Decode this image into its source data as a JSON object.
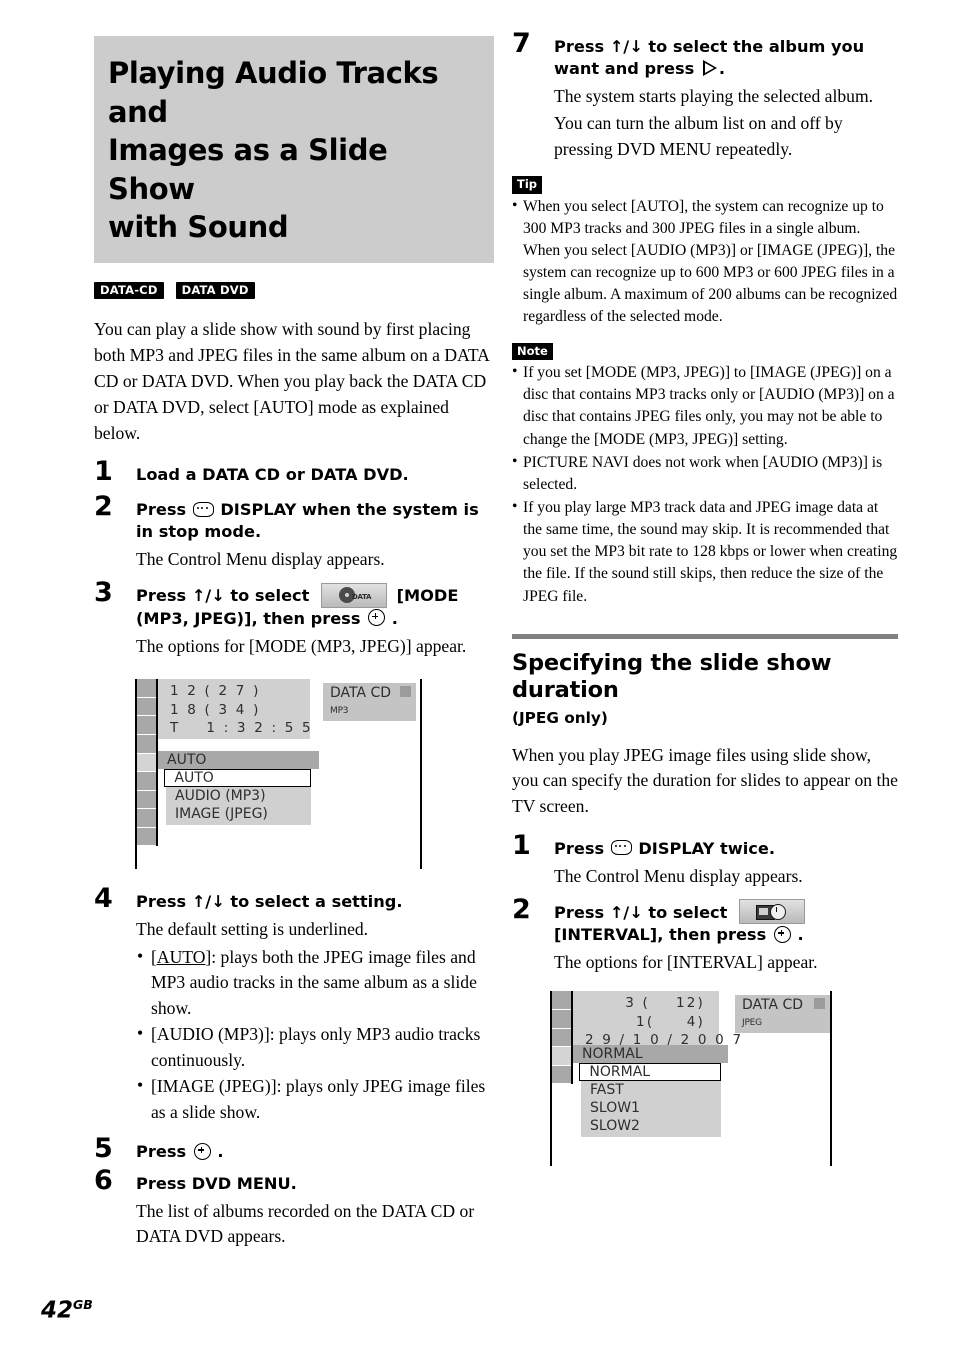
{
  "page": {
    "number": "42",
    "region": "GB"
  },
  "chapter": {
    "title_lines": [
      "Playing Audio Tracks and",
      "Images as a Slide Show",
      "with Sound"
    ],
    "badges": [
      "DATA-CD",
      "DATA DVD"
    ],
    "intro": "You can play a slide show with sound by first placing both MP3 and JPEG files in the same album on a DATA CD or DATA DVD. When you play back the DATA CD or DATA DVD, select [AUTO] mode as explained below."
  },
  "steps_main": [
    {
      "num": "1",
      "head_pre": "Load a DATA CD or DATA DVD.",
      "body": []
    },
    {
      "num": "2",
      "head_pre": "Press ",
      "head_icon": "display-icon",
      "head_post": " DISPLAY when the system is in stop mode.",
      "body": [
        "The Control Menu display appears."
      ]
    },
    {
      "num": "3",
      "head_pre": "Press ↑/↓ to select ",
      "head_icon": "mode-icon",
      "head_mid": " [MODE (MP3, JPEG)], then press ",
      "head_icon2": "enter-icon",
      "head_post": " .",
      "body": [
        "The options for [MODE (MP3, JPEG)] appear."
      ]
    },
    {
      "num": "4",
      "head_pre": "Press ↑/↓ to select a setting.",
      "body": [
        "The default setting is underlined."
      ],
      "bullets": [
        {
          "key": "[AUTO]",
          "underline_key": "AUTO",
          "text": ": plays both the JPEG image files and MP3 audio tracks in the same album as a slide show."
        },
        {
          "key": "[AUDIO (MP3)]",
          "text": ": plays only MP3 audio tracks continuously."
        },
        {
          "key": "[IMAGE (JPEG)]",
          "text": ": plays only JPEG image files as a slide show."
        }
      ]
    },
    {
      "num": "5",
      "head_pre": "Press ",
      "head_icon": "enter-icon",
      "head_post": " .",
      "body": []
    },
    {
      "num": "6",
      "head_pre": "Press DVD MENU.",
      "body": [
        "The list of albums recorded on the DATA CD or DATA DVD appears."
      ]
    },
    {
      "num": "7",
      "head_pre": "Press ↑/↓ to select the album you want and press ",
      "head_icon": "play-icon",
      "head_post": ".",
      "body": [
        "The system starts playing the selected album.",
        "You can turn the album list on and off by pressing DVD MENU repeatedly."
      ]
    }
  ],
  "tip": {
    "label": "Tip",
    "items": [
      "When you select [AUTO], the system can recognize up to 300 MP3 tracks and 300 JPEG files in a single album. When you select [AUDIO (MP3)] or [IMAGE (JPEG)], the system can recognize up to 600 MP3 or 600 JPEG files in a single album. A maximum of 200 albums can be recognized regardless of the selected mode."
    ]
  },
  "note": {
    "label": "Note",
    "items": [
      "If you set [MODE (MP3, JPEG)] to [IMAGE (JPEG)] on a disc that contains MP3 tracks only or [AUDIO (MP3)] on a disc that contains JPEG files only, you may not be able to change the [MODE (MP3, JPEG)] setting.",
      "PICTURE NAVI does not work when [AUDIO (MP3)] is selected.",
      "If you play large MP3 track data and JPEG image data at the same time, the sound may skip. It is recommended that you set the MP3 bit rate to 128 kbps or lower when creating the file. If the sound still skips, then reduce the size of the JPEG file."
    ]
  },
  "section": {
    "heading_lines": [
      "Specifying the slide show",
      "duration"
    ],
    "subheading": "(JPEG only)",
    "intro": "When you play JPEG image files using slide show, you can specify the duration for slides to appear on the TV screen.",
    "steps": [
      {
        "num": "1",
        "head_pre": "Press ",
        "head_icon": "display-icon",
        "head_post": " DISPLAY twice.",
        "body": [
          "The Control Menu display appears."
        ]
      },
      {
        "num": "2",
        "head_pre": "Press ↑/↓ to select ",
        "head_icon": "interval-icon",
        "head_mid": " [INTERVAL], then press ",
        "head_icon2": "enter-icon",
        "head_post": " .",
        "body": [
          "The options for [INTERVAL] appear."
        ]
      }
    ]
  },
  "osd_mode": {
    "info_lines": [
      "1 2 ( 2 7 )",
      "1 8 ( 3 4 )",
      "T    1 : 3 2 : 5 5"
    ],
    "current": "AUTO",
    "options": [
      "AUTO",
      "AUDIO (MP3)",
      "IMAGE (JPEG)"
    ],
    "disc_label": "DATA CD",
    "disc_format": "MP3",
    "icon_cells": 9,
    "selected_cell_index": 4
  },
  "osd_interval": {
    "info_lines": [
      "3 (    12)",
      "1(     4)",
      "2 9 / 1 0 / 2 0 0 7"
    ],
    "current": "NORMAL",
    "options": [
      "NORMAL",
      "FAST",
      "SLOW1",
      "SLOW2"
    ],
    "disc_label": "DATA CD",
    "disc_format": "JPEG",
    "icon_cells": 5,
    "selected_cell_index": 3
  },
  "colors": {
    "title_bg": "#cccccc",
    "rule": "#808080",
    "osd_info_bg": "#d0d0d0",
    "osd_cursor_bg": "#a8a8a8"
  }
}
